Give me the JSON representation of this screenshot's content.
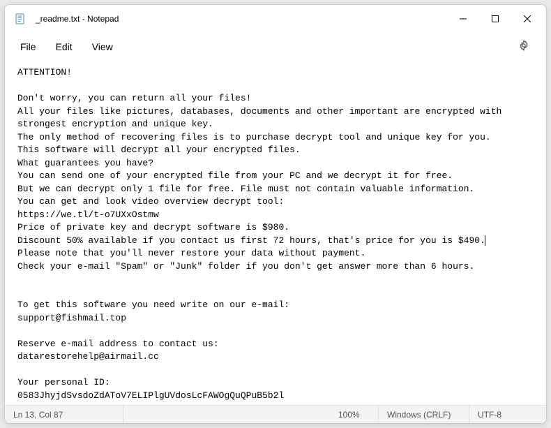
{
  "title": "_readme.txt - Notepad",
  "menu": {
    "file": "File",
    "edit": "Edit",
    "view": "View"
  },
  "content": {
    "l1": "ATTENTION!",
    "l2": "",
    "l3": "Don't worry, you can return all your files!",
    "l4": "All your files like pictures, databases, documents and other important are encrypted with strongest encryption and unique key.",
    "l5": "The only method of recovering files is to purchase decrypt tool and unique key for you.",
    "l6": "This software will decrypt all your encrypted files.",
    "l7": "What guarantees you have?",
    "l8": "You can send one of your encrypted file from your PC and we decrypt it for free.",
    "l9": "But we can decrypt only 1 file for free. File must not contain valuable information.",
    "l10": "You can get and look video overview decrypt tool:",
    "l11": "https://we.tl/t-o7UXxOstmw",
    "l12": "Price of private key and decrypt software is $980.",
    "l13": "Discount 50% available if you contact us first 72 hours, that's price for you is $490.",
    "l14": "Please note that you'll never restore your data without payment.",
    "l15": "Check your e-mail \"Spam\" or \"Junk\" folder if you don't get answer more than 6 hours.",
    "l16": "",
    "l17": "",
    "l18": "To get this software you need write on our e-mail:",
    "l19": "support@fishmail.top",
    "l20": "",
    "l21": "Reserve e-mail address to contact us:",
    "l22": "datarestorehelp@airmail.cc",
    "l23": "",
    "l24": "Your personal ID:",
    "l25": "0583JhyjdSvsdoZdAToV7ELIPlgUVdosLcFAWOgQuQPuB5b2l"
  },
  "status": {
    "pos": "Ln 13, Col 87",
    "zoom": "100%",
    "eol": "Windows (CRLF)",
    "enc": "UTF-8"
  }
}
